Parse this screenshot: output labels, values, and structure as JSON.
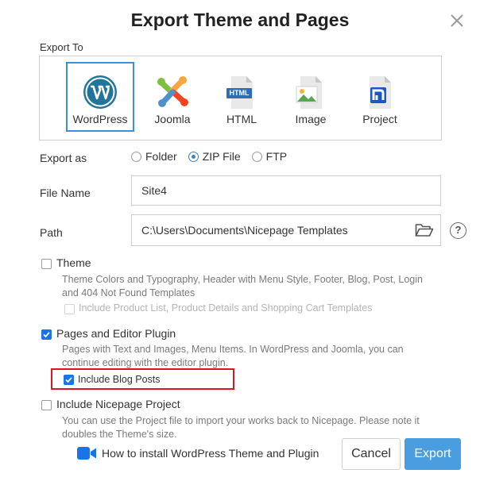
{
  "dialog": {
    "title": "Export Theme and Pages"
  },
  "export_to": {
    "label": "Export To",
    "options": [
      {
        "label": "WordPress",
        "icon": "wordpress-icon",
        "selected": true
      },
      {
        "label": "Joomla",
        "icon": "joomla-icon",
        "selected": false
      },
      {
        "label": "HTML",
        "icon": "html-file-icon",
        "selected": false
      },
      {
        "label": "Image",
        "icon": "image-file-icon",
        "selected": false
      },
      {
        "label": "Project",
        "icon": "nicepage-project-icon",
        "selected": false
      }
    ],
    "html_badge": "HTML"
  },
  "export_as": {
    "label": "Export as",
    "options": [
      {
        "label": "Folder",
        "selected": false
      },
      {
        "label": "ZIP File",
        "selected": true
      },
      {
        "label": "FTP",
        "selected": false
      }
    ]
  },
  "file_name": {
    "label": "File Name",
    "value": "Site4"
  },
  "path": {
    "label": "Path",
    "value": "C:\\Users\\Documents\\Nicepage Templates",
    "help_glyph": "?"
  },
  "theme": {
    "label": "Theme",
    "checked": false,
    "description": "Theme Colors and Typography, Header with Menu Style, Footer, Blog, Post, Login and 404 Not Found Templates",
    "sub_option": {
      "label": "Include Product List, Product Details and Shopping Cart Templates",
      "checked": false,
      "disabled": true
    }
  },
  "pages": {
    "label": "Pages and Editor Plugin",
    "checked": true,
    "description": "Pages with Text and Images, Menu Items. In WordPress and Joomla, you can continue editing with the editor plugin.",
    "sub_option": {
      "label": "Include Blog Posts",
      "checked": true
    }
  },
  "project": {
    "label": "Include Nicepage Project",
    "checked": false,
    "description": "You can use the Project file to import your works back to Nicepage. Please note it doubles the Theme's size."
  },
  "footer": {
    "video_link": "How to install WordPress Theme and Plugin",
    "cancel_label": "Cancel",
    "export_label": "Export"
  },
  "colors": {
    "accent": "#4a9ee0",
    "highlight_border": "#e0141e",
    "checkbox_blue": "#1a73e8"
  }
}
